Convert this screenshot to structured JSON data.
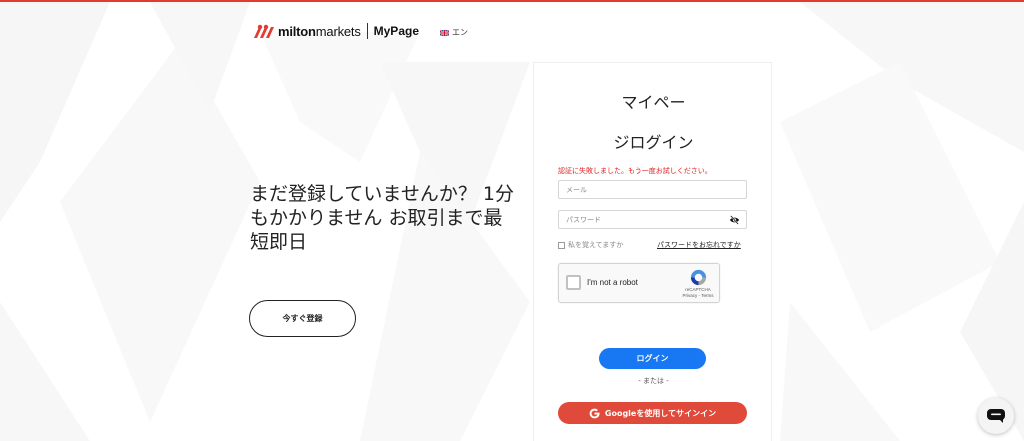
{
  "colors": {
    "brand_red": "#e23b30",
    "primary_blue": "#1877f2",
    "google_red": "#e04a3a",
    "error_red": "#e02020"
  },
  "header": {
    "logo_bold": "milton",
    "logo_light": "markets",
    "mypage": "MyPage",
    "language": "エン",
    "language_icon": "uk-flag-icon"
  },
  "promo": {
    "title": "まだ登録していませんか？ 1分もかかりません お取引まで最短即日",
    "register_button": "今すぐ登録"
  },
  "login_card": {
    "title_line1": "マイペー",
    "title_line2": "ジログイン",
    "error_message": "認証に失敗しました。もう一度お試しください。",
    "email_placeholder": "メール",
    "email_value": "",
    "password_placeholder": "パスワード",
    "password_value": "",
    "password_toggle_icon": "eye-slash-icon",
    "remember_me": "私を覚えてますか",
    "forgot_password": "パスワードをお忘れですか",
    "recaptcha": {
      "label": "I'm not a robot",
      "brand": "reCAPTCHA",
      "links": "Privacy - Terms"
    },
    "login_button": "ログイン",
    "or_text": "- または -",
    "google_button": "Googleを使用してサインイン"
  },
  "chat": {
    "icon": "chat-bubble-icon"
  }
}
